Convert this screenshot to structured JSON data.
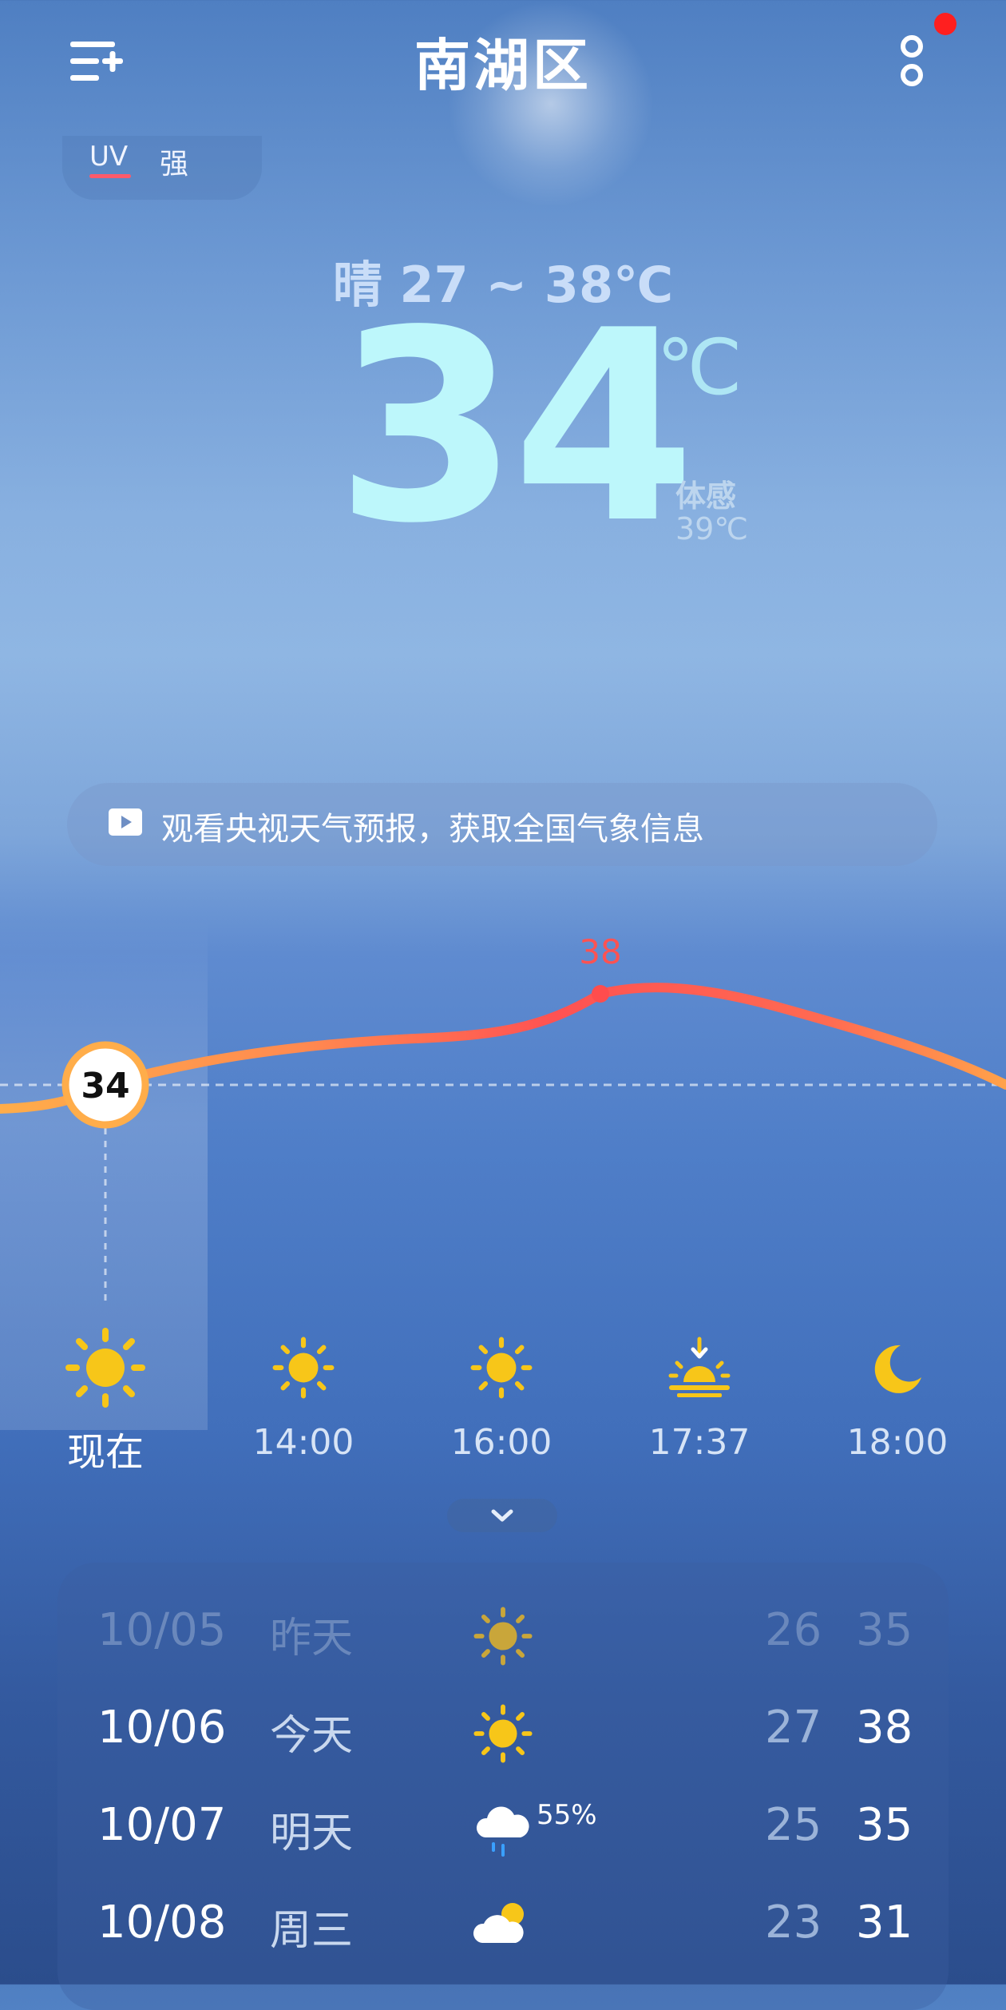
{
  "header": {
    "location": "南湖区",
    "menu_icon": "list-add-icon",
    "more_icon": "more-dots-icon"
  },
  "uv": {
    "label": "UV",
    "value": "强"
  },
  "current": {
    "condition_range": "晴  27 ~ 38℃",
    "temperature": "34",
    "unit": "℃",
    "feels_like_label": "体感",
    "feels_like_value": "39℃"
  },
  "banner": {
    "text": "观看央视天气预报，获取全国气象信息"
  },
  "chart_data": {
    "type": "line",
    "current_value_label": "34",
    "peak_label": "38",
    "current_value": 34,
    "peak_value": 38
  },
  "hourly": [
    {
      "label": "现在",
      "icon": "sun-icon"
    },
    {
      "label": "14:00",
      "icon": "sun-icon"
    },
    {
      "label": "16:00",
      "icon": "sun-icon"
    },
    {
      "label": "17:37",
      "icon": "sunset-icon"
    },
    {
      "label": "18:00",
      "icon": "moon-icon"
    }
  ],
  "daily": [
    {
      "date": "10/05",
      "day": "昨天",
      "icon": "sun-icon",
      "pct": "",
      "low": "26",
      "high": "35"
    },
    {
      "date": "10/06",
      "day": "今天",
      "icon": "sun-icon",
      "pct": "",
      "low": "27",
      "high": "38"
    },
    {
      "date": "10/07",
      "day": "明天",
      "icon": "rain-cloud-icon",
      "pct": "55%",
      "low": "25",
      "high": "35"
    },
    {
      "date": "10/08",
      "day": "周三",
      "icon": "partly-cloudy-icon",
      "pct": "",
      "low": "23",
      "high": "31"
    }
  ],
  "colors": {
    "sun": "#f7c619",
    "curve_hot": "#ff5252",
    "curve_warm": "#ffad4a",
    "temp_text": "#bdf7fb"
  }
}
